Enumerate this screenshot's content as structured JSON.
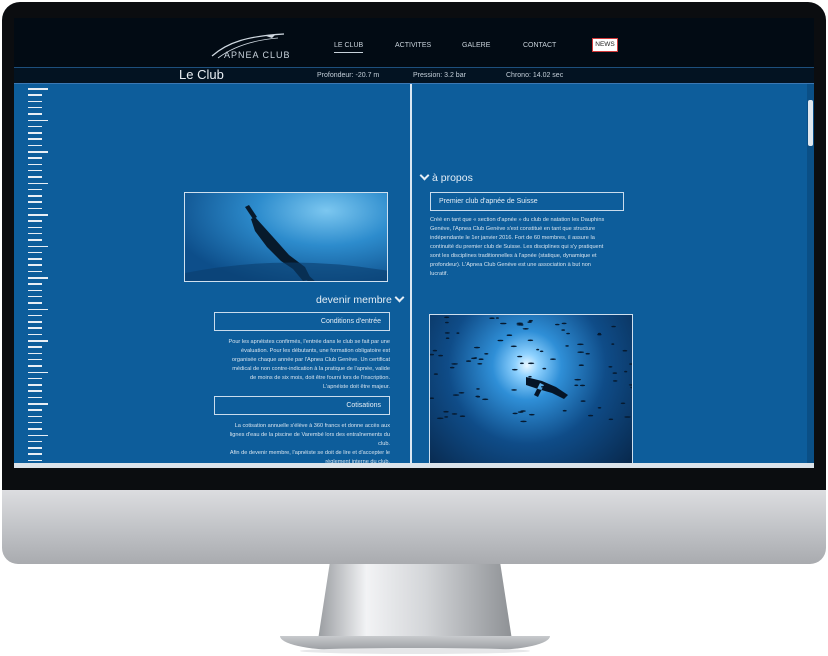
{
  "nav": {
    "logo_text": "APNEA CLUB",
    "items": [
      {
        "label": "LE CLUB"
      },
      {
        "label": "ACTIVITES"
      },
      {
        "label": "GALERE"
      },
      {
        "label": "CONTACT"
      }
    ],
    "news_label": "NEWS"
  },
  "status": {
    "page_title": "Le Club",
    "depth": "Profondeur: -20.7 m",
    "pressure": "Pression: 3.2 bar",
    "chrono": "Chrono: 14.02 sec"
  },
  "left": {
    "heading": "devenir membre",
    "box1": "Conditions d'entrée",
    "para1": [
      "Pour les apnéistes confirmés, l'entrée dans le club se fait par une",
      "évaluation. Pour les débutants, une formation obligatoire est",
      "organisée chaque année par l'Apnea Club Genève. Un certificat",
      "médical de non contre-indication à la pratique de l'apnée, valide",
      "de moins de six mois, doit être fourni lors de l'inscription.",
      "L'apnéiste doit être majeur."
    ],
    "box2": "Cotisations",
    "para2": [
      "La cotisation annuelle s'élève à 360 francs et donne accès aux",
      "lignes d'eau de la piscine de Varembé lors des entraînements du",
      "club.",
      "Afin de devenir membre, l'apnéiste se doit de lire et d'accepter le",
      "règlement interne du club."
    ]
  },
  "right": {
    "heading": "à propos",
    "box1": "Premier club d'apnée de Suisse",
    "para1": [
      "Créé en tant que « section d'apnée » du club de natation les Dauphins",
      "Genève, l'Apnea Club Genève s'est constitué en tant que structure",
      "indépendante le 1er janvier 2016. Fort de 60 membres, il assure la",
      "continuité du premier club de Suisse. Les disciplines qui s'y pratiquent",
      "sont les disciplines traditionnelles à l'apnée (statique, dynamique et",
      "profondeur). L'Apnea Club Genève est une association à but non",
      "lucratif."
    ]
  },
  "colors": {
    "accent": "#0d5d9b",
    "news_border": "#d23a3a"
  }
}
